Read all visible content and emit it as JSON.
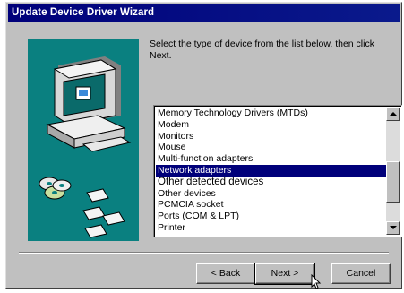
{
  "window": {
    "title": "Update Device Driver Wizard"
  },
  "instructions": "Select the type of device from the list below, then click Next.",
  "device_list": {
    "items": [
      "Memory Technology Drivers (MTDs)",
      "Modem",
      "Monitors",
      "Mouse",
      "Multi-function adapters",
      "Network adapters",
      "Other detected devices",
      "Other devices",
      "PCMCIA socket",
      "Ports (COM & LPT)",
      "Printer"
    ],
    "selected": "Network adapters"
  },
  "buttons": {
    "back": "< Back",
    "next": "Next >",
    "cancel": "Cancel"
  },
  "colors": {
    "title_bar": "#00007a",
    "selection": "#00007a",
    "wizard_art_background": "#0a8080",
    "dialog_face": "#c0c0c0"
  },
  "icons": [
    "computer-icon",
    "cd-disc-icon",
    "floppy-disk-icon",
    "scroll-up-arrow-icon",
    "scroll-down-arrow-icon",
    "mouse-cursor-icon"
  ]
}
